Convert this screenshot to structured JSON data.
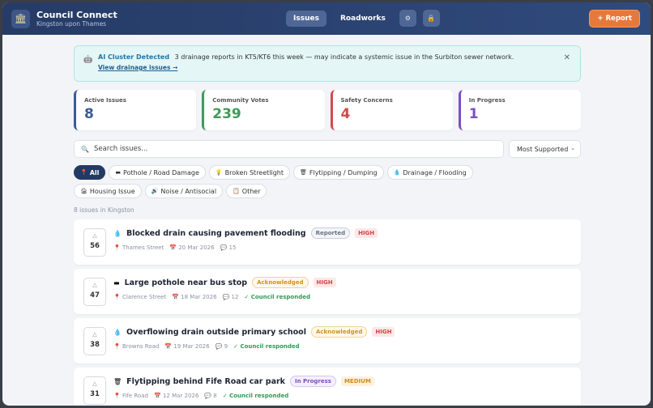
{
  "header": {
    "app_title": "Council Connect",
    "subtitle": "Kingston upon Thames",
    "tabs": [
      {
        "label": "Issues",
        "active": true
      },
      {
        "label": "Roadworks",
        "active": false
      }
    ],
    "report_label": "+ Report",
    "icons": [
      "settings-icon",
      "lock-icon"
    ],
    "colors": {
      "header_bg": "#2f4a7c",
      "accent": "#e5793d"
    }
  },
  "alert": {
    "title": "AI Cluster Detected",
    "text": "3 drainage reports in KT5/KT6 this week — may indicate a systemic issue in the Surbiton sewer network.",
    "link": "View drainage issues →",
    "close": "✕"
  },
  "stats": [
    {
      "label": "Active Issues",
      "value": "8",
      "color": "#3b5b9b"
    },
    {
      "label": "Community Votes",
      "value": "239",
      "color": "#3f9a5a"
    },
    {
      "label": "Safety Concerns",
      "value": "4",
      "color": "#d14b4b"
    },
    {
      "label": "In Progress",
      "value": "1",
      "color": "#7a4fc4"
    }
  ],
  "search": {
    "placeholder": "Search issues...",
    "sort_value": "Most Supported"
  },
  "categories": [
    {
      "icon": "📍",
      "label": "All",
      "active": true
    },
    {
      "icon": "▬",
      "label": "Pothole / Road Damage",
      "active": false
    },
    {
      "icon": "💡",
      "label": "Broken Streetlight",
      "active": false
    },
    {
      "icon": "🗑",
      "label": "Flytipping / Dumping",
      "active": false
    },
    {
      "icon": "💧",
      "label": "Drainage / Flooding",
      "active": false
    },
    {
      "icon": "🏚",
      "label": "Housing Issue",
      "active": false
    },
    {
      "icon": "🔊",
      "label": "Noise / Antisocial",
      "active": false
    },
    {
      "icon": "📋",
      "label": "Other",
      "active": false
    }
  ],
  "issue_count": "8 issues in Kingston",
  "issues": [
    {
      "votes": "56",
      "icon": "💧",
      "title": "Blocked drain causing pavement flooding",
      "status": "Reported",
      "priority": "HIGH",
      "location": "Thames Street",
      "date": "20 Mar 2026",
      "comments": "15",
      "responded": ""
    },
    {
      "votes": "47",
      "icon": "▬",
      "title": "Large pothole near bus stop",
      "status": "Acknowledged",
      "priority": "HIGH",
      "location": "Clarence Street",
      "date": "18 Mar 2026",
      "comments": "12",
      "responded": "✓ Council responded"
    },
    {
      "votes": "38",
      "icon": "💧",
      "title": "Overflowing drain outside primary school",
      "status": "Acknowledged",
      "priority": "HIGH",
      "location": "Browns Road",
      "date": "19 Mar 2026",
      "comments": "9",
      "responded": "✓ Council responded"
    },
    {
      "votes": "31",
      "icon": "🗑",
      "title": "Flytipping behind Fife Road car park",
      "status": "In Progress",
      "priority": "MEDIUM",
      "location": "Fife Road",
      "date": "12 Mar 2026",
      "comments": "8",
      "responded": "✓ Council responded"
    }
  ]
}
